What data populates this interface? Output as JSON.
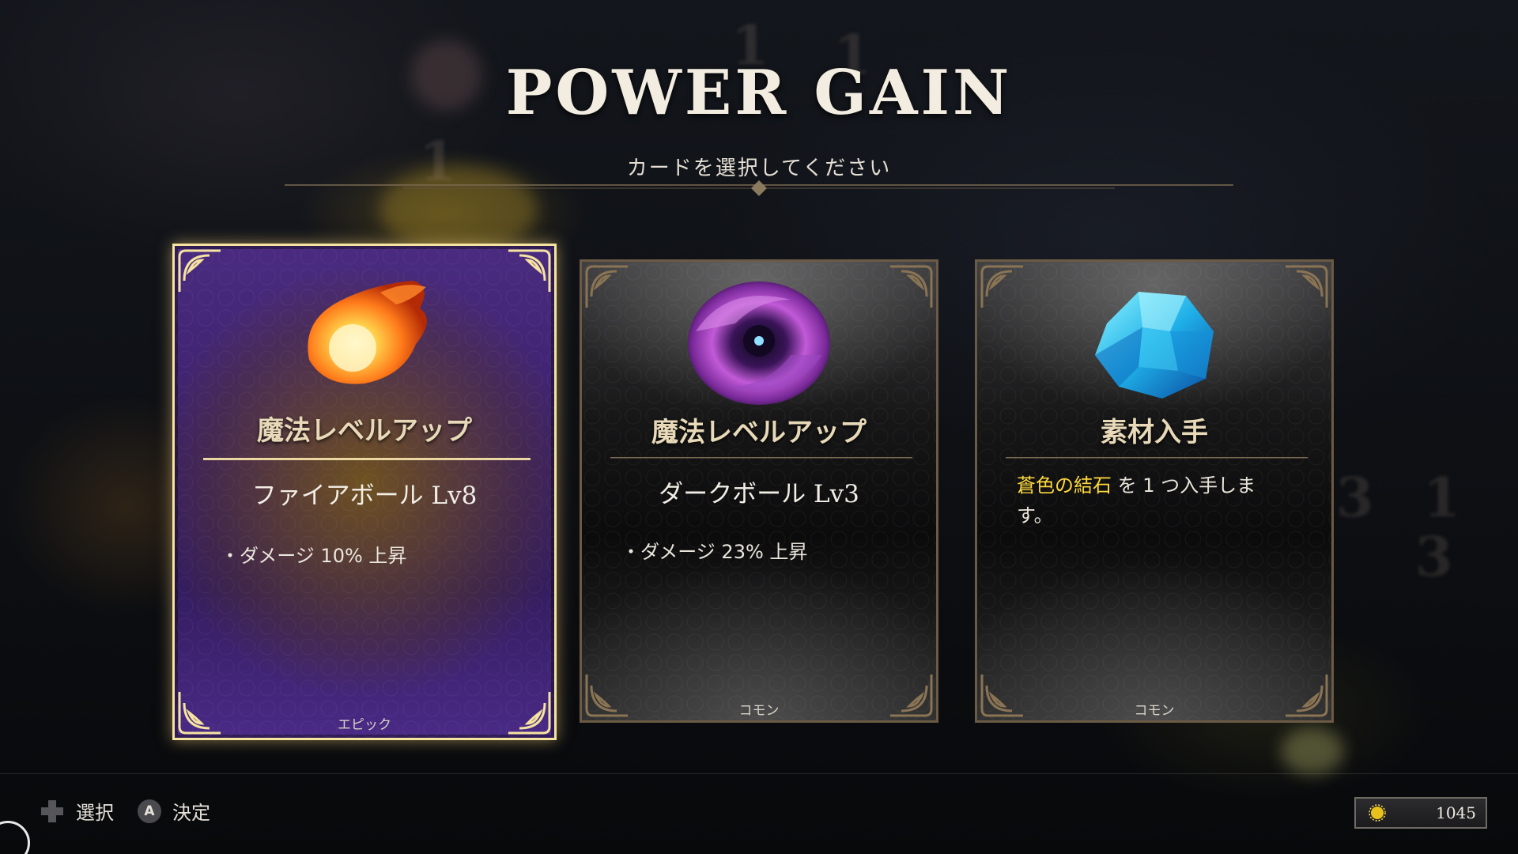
{
  "title": "POWER GAIN",
  "subtitle": "カードを選択してください",
  "cards": [
    {
      "name": "魔法レベルアップ",
      "spell": "ファイアボール Lv8",
      "effect": "・ダメージ 10% 上昇",
      "rarity": "エピック",
      "icon": "fireball-icon",
      "selected": true
    },
    {
      "name": "魔法レベルアップ",
      "spell": "ダークボール Lv3",
      "effect": "・ダメージ 23% 上昇",
      "rarity": "コモン",
      "icon": "dark-orb-icon",
      "selected": false
    },
    {
      "name": "素材入手",
      "desc_highlight": "蒼色の結石",
      "desc_rest": " を 1 つ入手します。",
      "rarity": "コモン",
      "icon": "blue-crystal-icon",
      "selected": false
    }
  ],
  "controls": {
    "select_label": "選択",
    "confirm_button": "A",
    "confirm_label": "決定"
  },
  "currency": {
    "value": "1045",
    "icon": "gold-coin-icon"
  },
  "colors": {
    "selected_border": "#f5e3a0",
    "epic_bg": "#3a1f6a",
    "highlight": "#ffd93b"
  }
}
